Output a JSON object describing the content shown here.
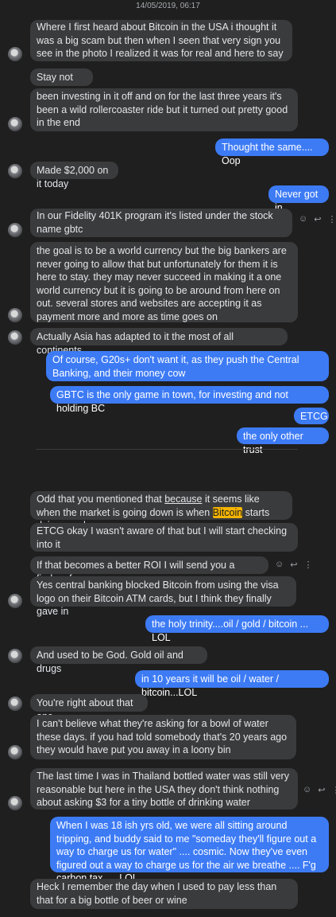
{
  "timestamp": "14/05/2019, 06:17",
  "messages": {
    "m1": "Where I  first heard about Bitcoin in the USA i thought it was a big scam but then when I seen that very sign you see in the photo I realized it was for real and here to say",
    "m2": "Stay not say",
    "m3": "been investing in it off and on for the last three years it's been a wild rollercoaster ride but it turned out pretty good in the end",
    "m4": "Thought the same.... Oop",
    "m5": "Made $2,000 on it today",
    "m6": "Never got in",
    "m7": "In our Fidelity 401K program it's listed under the stock name gbtc",
    "m8": "the goal is to be a  world currency but the big bankers are never going to allow that but unfortunately for them it is here to stay. they may never succeed in making it a one world currency but it is going to  be around from here on out. several stores and websites are accepting it as payment more and more as time goes on",
    "m9": "Actually Asia  has adapted to it the most of all continents",
    "m10": "Of course, G20s+ don't want it, as they push the Central Banking, and their money cow",
    "m11": "GBTC is the only game in town, for investing and not holding BC",
    "m12": "ETCG",
    "m13": "the only other trust",
    "m14_a": "Odd that you mentioned that ",
    "m14_b": "because",
    "m14_c": " it seems like when the market is going down is when ",
    "m14_d": "Bitcoin",
    "m14_e": " starts doing good",
    "m15": "ETCG okay I wasn't aware of that but I will start checking into it",
    "m16": "If that becomes a better ROI I will send you a finders fee",
    "m17": "Yes central banking blocked Bitcoin from using the visa logo on their Bitcoin ATM cards, but I think they finally gave in",
    "m18": "the holy trinity....oil / gold / bitcoin ... LOL",
    "m19": "And used to be God. Gold oil and drugs",
    "m20": "in 10 years it will be oil / water / bitcoin...LOL",
    "m21": "You're right about that one",
    "m22": "I can't believe what they're asking for a bowl of water these days. if you had told somebody that's 20 years ago they would have put you away in a loony bin",
    "m23": "The last time I was in Thailand bottled water was still very reasonable but here in the USA they don't think nothing about asking $3 for a tiny bottle of drinking water",
    "m24": "When I was 18 ish yrs old, we were all sitting around tripping, and buddy said to me \"someday they'll figure out a way to charge us for water\" .... cosmic.   Now they've even figured out a way to charge us for the air we breathe .... F'g carbon tax .... LOL",
    "m25": "Heck I remember the day when I used to pay less than that for a big bottle of  beer or wine"
  },
  "actions": {
    "react_icon": "smiley-face",
    "reply_icon": "reply-arrow",
    "more_icon": "vertical-ellipsis",
    "react_glyph": "☺",
    "reply_glyph": "↩",
    "more_glyph": "⋮"
  },
  "colors": {
    "background": "#1f1f20",
    "incoming_bubble": "#3a3b3c",
    "outgoing_bubble": "#3d7bf5",
    "highlight": "#f4b400"
  }
}
